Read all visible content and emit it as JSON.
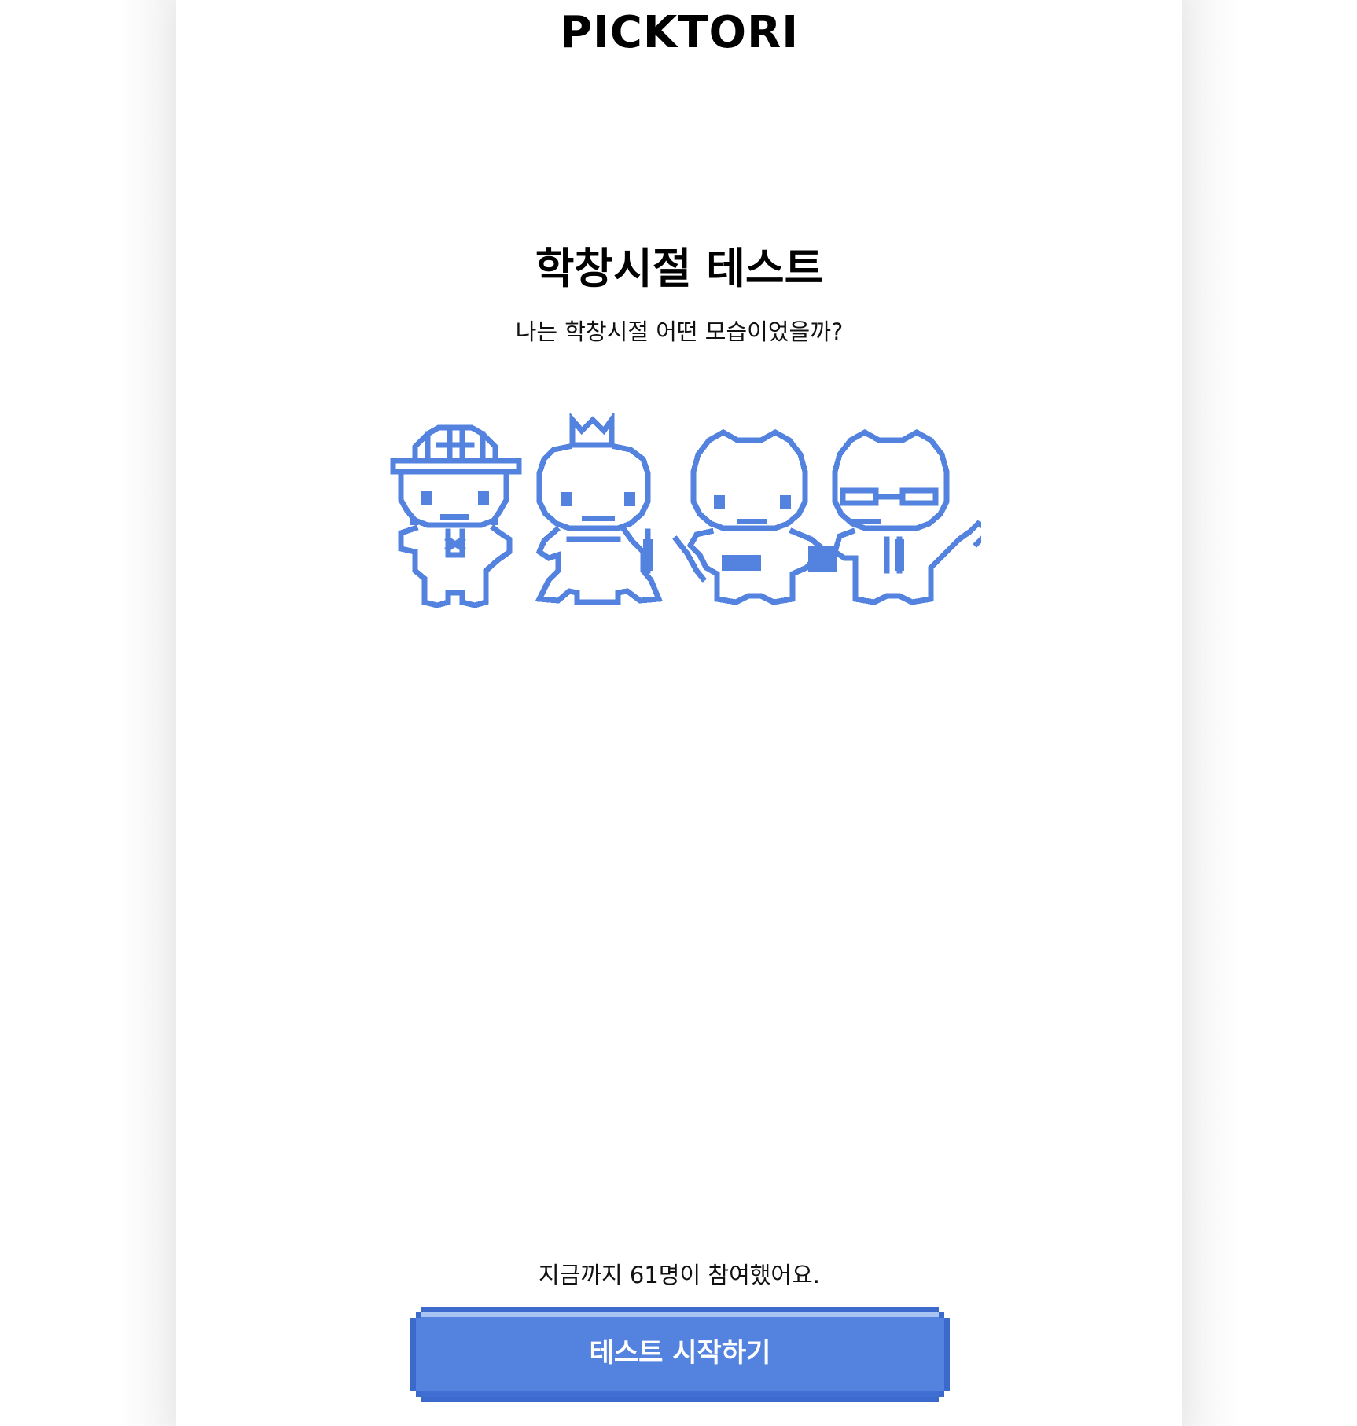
{
  "header": {
    "logo": "PICKTORI"
  },
  "main": {
    "title": "학창시절 테스트",
    "subtitle": "나는 학창시절 어떤 모습이었을까?",
    "illustration_icon": "pixel-characters-illustration",
    "participants_text": "지금까지 61명이 참여했어요.",
    "start_button_label": "테스트 시작하기"
  },
  "colors": {
    "accent": "#5383DE",
    "accent_dark": "#3B6ACC",
    "accent_light": "#A8C4F2",
    "text": "#000000",
    "background": "#FFFFFF"
  }
}
